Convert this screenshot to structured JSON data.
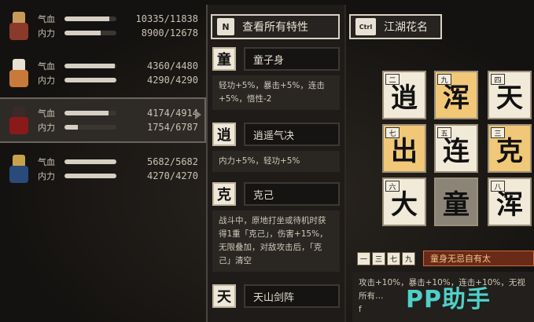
{
  "party": [
    {
      "hp_label": "气血",
      "hp_value": "10335/11838",
      "hp_frac": 0.87,
      "mp_label": "内力",
      "mp_value": "8900/12678",
      "mp_frac": 0.7,
      "colors": {
        "head": "#c89a5a",
        "body": "#8a3a2a"
      }
    },
    {
      "hp_label": "气血",
      "hp_value": "4360/4480",
      "hp_frac": 0.97,
      "mp_label": "内力",
      "mp_value": "4290/4290",
      "mp_frac": 1.0,
      "colors": {
        "head": "#e8e0d0",
        "body": "#c87a3a"
      }
    },
    {
      "hp_label": "气血",
      "hp_value": "4174/4914",
      "hp_frac": 0.85,
      "mp_label": "内力",
      "mp_value": "1754/6787",
      "mp_frac": 0.26,
      "colors": {
        "head": "#3a2a2a",
        "body": "#8a1a1a"
      }
    },
    {
      "hp_label": "气血",
      "hp_value": "5682/5682",
      "hp_frac": 1.0,
      "mp_label": "内力",
      "mp_value": "4270/4270",
      "mp_frac": 1.0,
      "colors": {
        "head": "#c8a24a",
        "body": "#2a4a7a"
      }
    }
  ],
  "view_traits_button": {
    "key": "N",
    "label": "查看所有特性"
  },
  "traits": [
    {
      "icon": "童",
      "name": "童子身",
      "desc": "轻功+5%，暴击+5%，连击+5%，悟性-2"
    },
    {
      "icon": "逍",
      "name": "逍遥气决",
      "desc": "内力+5%，轻功+5%"
    },
    {
      "icon": "克",
      "name": "克己",
      "desc": "战斗中，原地打坐或待机时获得1重「克己」，伤害+15%，无限叠加，对敌攻击后，「克己」清空"
    },
    {
      "icon": "天",
      "name": "天山剑阵",
      "desc": ""
    }
  ],
  "nickname_button": {
    "key": "Ctrl",
    "label": "江湖花名"
  },
  "board": [
    {
      "badge": "二",
      "char": "逍",
      "style": "light"
    },
    {
      "badge": "九",
      "char": "浑",
      "style": "gold"
    },
    {
      "badge": "四",
      "char": "天",
      "style": "light"
    },
    {
      "badge": "七",
      "char": "出",
      "style": "gold"
    },
    {
      "badge": "五",
      "char": "连",
      "style": "light"
    },
    {
      "badge": "三",
      "char": "克",
      "style": "gold"
    },
    {
      "badge": "六",
      "char": "大",
      "style": "light"
    },
    {
      "badge": "",
      "char": "童",
      "style": "empty"
    },
    {
      "badge": "八",
      "char": "浑",
      "style": "light"
    }
  ],
  "combo_badges": [
    "一",
    "三",
    "七",
    "九"
  ],
  "combo_title": "童身无忌自有太",
  "combo_desc": "攻击+10%，暴击+10%，连击+10%，无视所有…",
  "combo_desc_tail": "f",
  "watermark": "PP助手"
}
